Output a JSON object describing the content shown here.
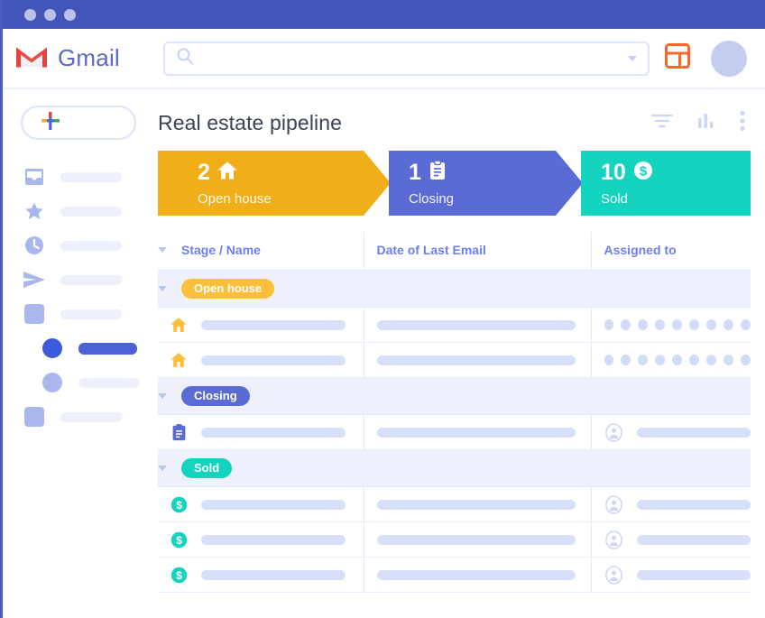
{
  "window": {
    "titlebar_dots": [
      "dot-1",
      "dot-2",
      "dot-3"
    ],
    "accent_indigo": "#4355b9"
  },
  "header": {
    "logo_icon": "gmail-m-icon",
    "brand": "Gmail",
    "search": {
      "value": "",
      "placeholder": "",
      "icon": "search-icon",
      "caret_icon": "chevron-down-icon"
    },
    "apps_icon": "dashboard-layout-icon",
    "avatar": "user-avatar"
  },
  "sidebar": {
    "compose": {
      "icon": "plus-icon",
      "label": ""
    },
    "items": [
      {
        "icon": "inbox-icon",
        "label": ""
      },
      {
        "icon": "star-icon",
        "label": ""
      },
      {
        "icon": "clock-icon",
        "label": ""
      },
      {
        "icon": "send-icon",
        "label": ""
      },
      {
        "icon": "square-icon",
        "label": ""
      }
    ],
    "labels": [
      {
        "icon": "circle-icon",
        "label": "",
        "active": true
      },
      {
        "icon": "circle-icon",
        "label": "",
        "active": false
      },
      {
        "icon": "square-icon",
        "label": "",
        "active": false
      }
    ]
  },
  "main": {
    "title": "Real estate pipeline",
    "toolbar": [
      {
        "icon": "filter-icon"
      },
      {
        "icon": "bar-chart-icon"
      },
      {
        "icon": "more-vertical-icon"
      }
    ]
  },
  "funnel": {
    "stages": [
      {
        "count": "2",
        "name": "Open house",
        "icon": "home-icon",
        "color": "#f0ae18"
      },
      {
        "count": "1",
        "name": "Closing",
        "icon": "clipboard-icon",
        "color": "#5b6bd6"
      },
      {
        "count": "10",
        "name": "Sold",
        "icon": "dollar-circle-icon",
        "color": "#14d3bf"
      }
    ]
  },
  "table": {
    "columns": [
      "Stage / Name",
      "Date of Last Email",
      "Assigned to"
    ],
    "groups": [
      {
        "label": "Open house",
        "pill_color": "#fbbf3b",
        "row_icon": "home-icon",
        "assigned_style": "dots",
        "assigned_dot_count": 9,
        "rows": [
          {
            "name": "",
            "date": "",
            "assigned": ""
          },
          {
            "name": "",
            "date": "",
            "assigned": ""
          }
        ]
      },
      {
        "label": "Closing",
        "pill_color": "#5b6bd6",
        "row_icon": "clipboard-icon",
        "assigned_style": "avatar",
        "rows": [
          {
            "name": "",
            "date": "",
            "assigned": ""
          }
        ]
      },
      {
        "label": "Sold",
        "pill_color": "#14d3bf",
        "row_icon": "dollar-circle-icon",
        "assigned_style": "avatar",
        "rows": [
          {
            "name": "",
            "date": "",
            "assigned": ""
          },
          {
            "name": "",
            "date": "",
            "assigned": ""
          },
          {
            "name": "",
            "date": "",
            "assigned": ""
          }
        ]
      }
    ]
  }
}
